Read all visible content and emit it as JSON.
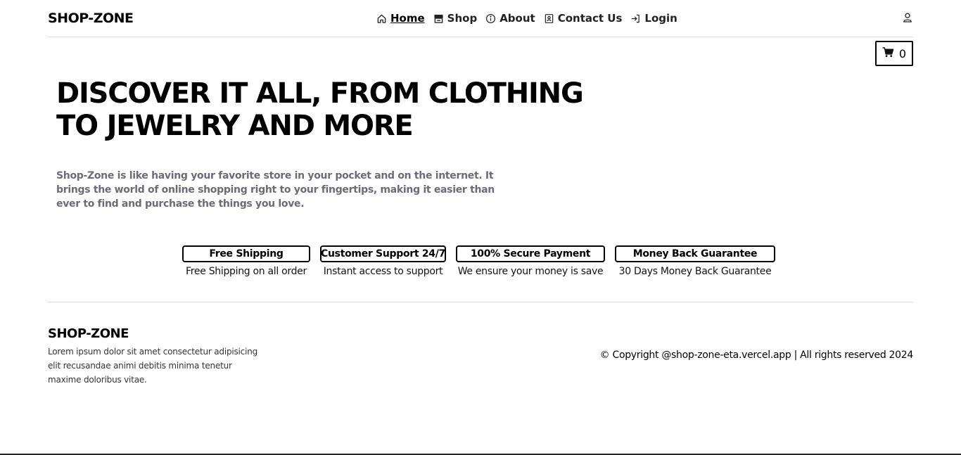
{
  "header": {
    "brand": "SHOP-ZONE",
    "nav": [
      {
        "label": "Home",
        "icon": "home-icon",
        "active": true
      },
      {
        "label": "Shop",
        "icon": "store-icon",
        "active": false
      },
      {
        "label": "About",
        "icon": "info-icon",
        "active": false
      },
      {
        "label": "Contact Us",
        "icon": "contact-card-icon",
        "active": false
      },
      {
        "label": "Login",
        "icon": "login-icon",
        "active": false
      }
    ],
    "user_icon": "user-icon",
    "cart": {
      "icon": "cart-icon",
      "count": "0"
    }
  },
  "hero": {
    "title_line1": "DISCOVER IT ALL, FROM CLOTHING",
    "title_line2": "TO JEWELRY AND MORE",
    "text": "Shop-Zone is like having your favorite store in your pocket and on the internet. It brings the world of online shopping right to your fingertips, making it easier than ever to find and purchase the things you love."
  },
  "features": [
    {
      "title": "Free Shipping",
      "desc": "Free Shipping on all order"
    },
    {
      "title": "Customer Support 24/7",
      "desc": "Instant access to support"
    },
    {
      "title": "100% Secure Payment",
      "desc": "We ensure your money is save"
    },
    {
      "title": "Money Back Guarantee",
      "desc": "30 Days Money Back Guarantee"
    }
  ],
  "footer": {
    "brand": "SHOP-ZONE",
    "text": "Lorem ipsum dolor sit amet consectetur adipisicing elit recusandae animi debitis minima tenetur maxime doloribus vitae.",
    "copyright": "© Copyright @shop-zone-eta.vercel.app | All rights reserved 2024"
  },
  "colors": {
    "text": "#000000",
    "muted": "#6b6b78",
    "divider": "#dcdcdc",
    "background": "#ffffff"
  }
}
